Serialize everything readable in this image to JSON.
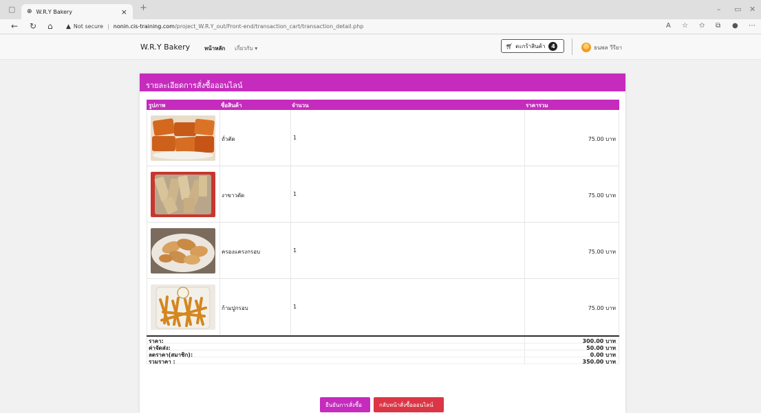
{
  "browser": {
    "tab_title": "W.R.Y Bakery",
    "security_label": "Not secure",
    "url_host": "nonin.cis-training.com",
    "url_path": "/project_W.R.Y_out/Front-end/transaction_cart/transaction_detail.php"
  },
  "navbar": {
    "brand": "W.R.Y Bakery",
    "home": "หน้าหลัก",
    "about": "เกี่ยวกับ",
    "cart_label": "ตะกร้าสินค้า",
    "cart_count": "4",
    "user_name": "ธนพล วีรียา"
  },
  "card": {
    "title": "รายละเอียดการสั่งซื้อออนไลน์",
    "columns": {
      "image": "รูปภาพ",
      "name": "ชื่อสินค้า",
      "qty": "จำนวน",
      "total": "ราคารวม"
    },
    "items": [
      {
        "name": "ถั่วตัด",
        "qty": "1",
        "price": "75.00 บาท"
      },
      {
        "name": "งาขาวตัด",
        "qty": "1",
        "price": "75.00 บาท"
      },
      {
        "name": "ครองแครงกรอบ",
        "qty": "1",
        "price": "75.00 บาท"
      },
      {
        "name": "ก้ามปูกรอบ",
        "qty": "1",
        "price": "75.00 บาท"
      }
    ],
    "summary": {
      "subtotal_label": "ราคา:",
      "subtotal": "300.00 บาท",
      "shipping_label": "ค่าจัดส่ง:",
      "shipping": "50.00 บาท",
      "discount_label": "ลดราคา(สมาชิก):",
      "discount": "0.00 บาท",
      "grand_label": "รวมราคา :",
      "grand": "350.00 บาท"
    },
    "buttons": {
      "confirm": "ยืนยันการสั่งซื้อ",
      "back": "กลับหน้าสั่งซื้อออนไลน์"
    }
  }
}
